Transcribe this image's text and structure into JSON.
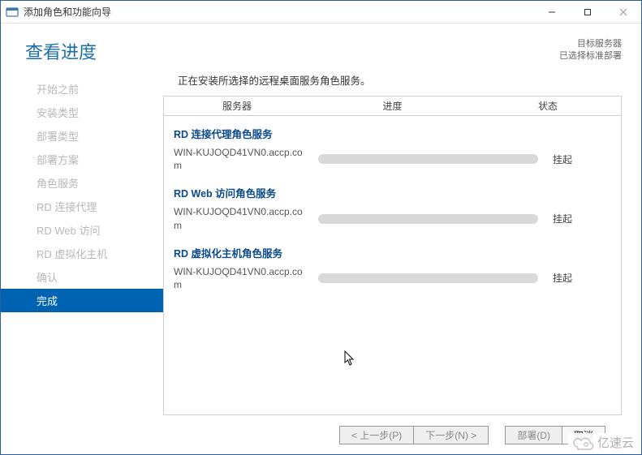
{
  "window": {
    "title": "添加角色和功能向导"
  },
  "header": {
    "title": "查看进度",
    "target_server_label": "目标服务器",
    "target_server_value": "已选择标准部署"
  },
  "sidebar": {
    "items": [
      {
        "label": "开始之前"
      },
      {
        "label": "安装类型"
      },
      {
        "label": "部署类型"
      },
      {
        "label": "部署方案"
      },
      {
        "label": "角色服务"
      },
      {
        "label": "RD 连接代理"
      },
      {
        "label": "RD Web 访问"
      },
      {
        "label": "RD 虚拟化主机"
      },
      {
        "label": "确认"
      },
      {
        "label": "完成"
      }
    ]
  },
  "content": {
    "intro": "正在安装所选择的远程桌面服务角色服务。",
    "columns": {
      "server": "服务器",
      "progress": "进度",
      "status": "状态"
    },
    "services": [
      {
        "title": "RD 连接代理角色服务",
        "server": "WIN-KUJOQD41VN0.accp.com",
        "status": "挂起"
      },
      {
        "title": "RD Web 访问角色服务",
        "server": "WIN-KUJOQD41VN0.accp.com",
        "status": "挂起"
      },
      {
        "title": "RD 虚拟化主机角色服务",
        "server": "WIN-KUJOQD41VN0.accp.com",
        "status": "挂起"
      }
    ]
  },
  "footer": {
    "prev": "< 上一步(P)",
    "next": "下一步(N) >",
    "deploy": "部署(D)",
    "cancel": "取消"
  },
  "overlay": {
    "logo_text": "亿速云"
  }
}
